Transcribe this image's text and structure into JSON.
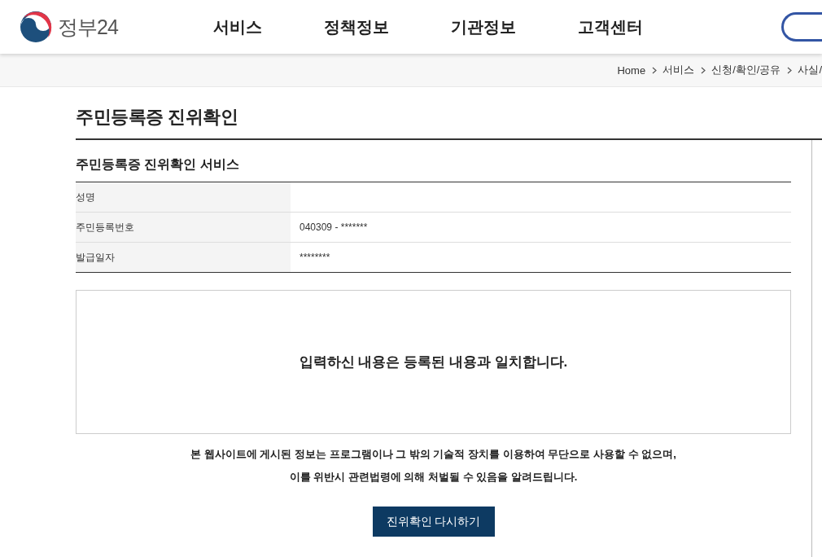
{
  "header": {
    "logo_text": "정부24",
    "nav": [
      "서비스",
      "정책정보",
      "기관정보",
      "고객센터"
    ]
  },
  "breadcrumb": [
    "Home",
    "서비스",
    "신청/확인/공유",
    "사실/"
  ],
  "page_title": "주민등록증 진위확인",
  "section_title": "주민등록증 진위확인 서비스",
  "rows": [
    {
      "label": "성명",
      "value": ""
    },
    {
      "label": "주민등록번호",
      "value": "040309 - *******"
    },
    {
      "label": "발급일자",
      "value": "********"
    }
  ],
  "result_message": "입력하신 내용은 등록된 내용과 일치합니다.",
  "notice": [
    "본 웹사이트에 게시된 정보는 프로그램이나 그 밖의 기술적 장치를 이용하여 무단으로 사용할 수 없으며,",
    "이를 위반시 관련법령에 의해 처벌될 수 있음을 알려드립니다."
  ],
  "retry_button": "진위확인 다시하기"
}
